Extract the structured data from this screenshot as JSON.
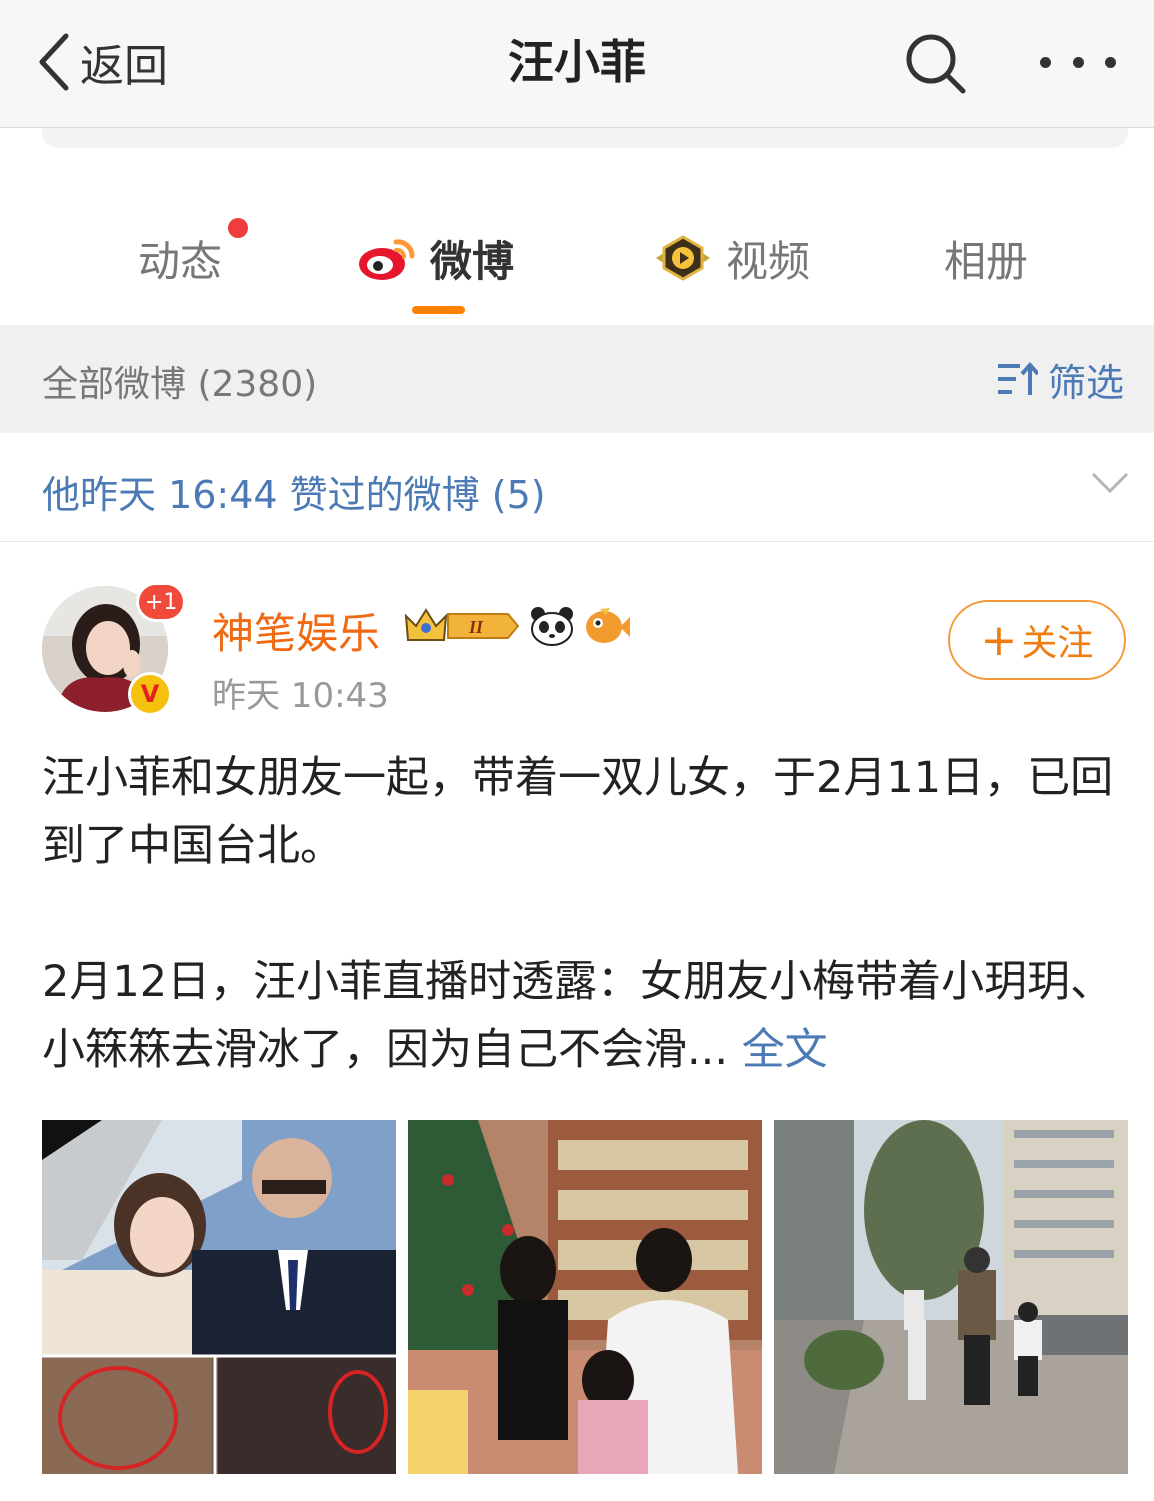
{
  "header": {
    "back_label": "返回",
    "title": "汪小菲"
  },
  "tabs": [
    {
      "label": "动态",
      "has_dot": true
    },
    {
      "label": "微博",
      "active": true
    },
    {
      "label": "视频"
    },
    {
      "label": "相册"
    }
  ],
  "filter": {
    "count_label": "全部微博 (2380)",
    "filter_label": "筛选"
  },
  "liked": {
    "text": "他昨天 16:44 赞过的微博 (5)"
  },
  "post": {
    "avatar_badge": "+1",
    "verified_mark": "V",
    "author": "神笔娱乐",
    "level_badge": "II",
    "time": "昨天 10:43",
    "follow_plus": "+",
    "follow_label": "关注",
    "paragraph1": "汪小菲和女朋友一起，带着一双儿女，于2月11日，已回到了中国台北。",
    "paragraph2": "2月12日，汪小菲直播时透露：女朋友小梅带着小玥玥、小箖箖去滑冰了，因为自己不会滑...",
    "more_link": "全文"
  },
  "colors": {
    "accent_orange": "#ff8200",
    "link_blue": "#4b7ab5",
    "author_orange": "#ef6a12",
    "red_dot": "#f03c3c"
  },
  "icons": [
    "chevron-left-icon",
    "search-icon",
    "more-icon",
    "weibo-logo-icon",
    "video-icon",
    "filter-icon",
    "chevron-down-icon",
    "crown-icon",
    "panda-icon",
    "fish-icon"
  ]
}
